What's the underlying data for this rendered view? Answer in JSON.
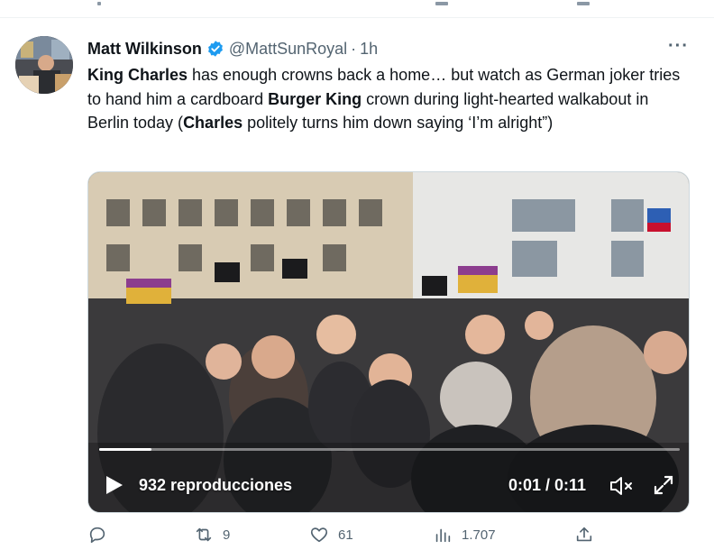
{
  "tweet": {
    "author_name": "Matt Wilkinson",
    "handle": "@MattSunRoyal",
    "separator": "·",
    "time": "1h",
    "more_label": "···",
    "text_segments": [
      {
        "text": "King Charles",
        "bold": true
      },
      {
        "text": " has enough crowns back a home… but watch as German joker tries to hand him a cardboard ",
        "bold": false
      },
      {
        "text": "Burger King",
        "bold": true
      },
      {
        "text": " crown during light-hearted walkabout in Berlin today (",
        "bold": false
      },
      {
        "text": "Charles",
        "bold": true
      },
      {
        "text": " politely turns him down saying ‘I’m alright”)",
        "bold": false
      }
    ]
  },
  "video": {
    "views": "932 reproducciones",
    "timecode": "0:01 / 0:11",
    "progress": 0.09,
    "play_icon": "play-icon",
    "mute_icon": "mute-icon",
    "fullscreen_icon": "fullscreen-icon"
  },
  "actions": {
    "reply_count": "",
    "retweet_count": "9",
    "like_count": "61",
    "views_count": "1.707",
    "share_count": ""
  },
  "colors": {
    "verified": "#1d9bf0",
    "secondary_text": "#536471",
    "primary_text": "#0f1419"
  }
}
